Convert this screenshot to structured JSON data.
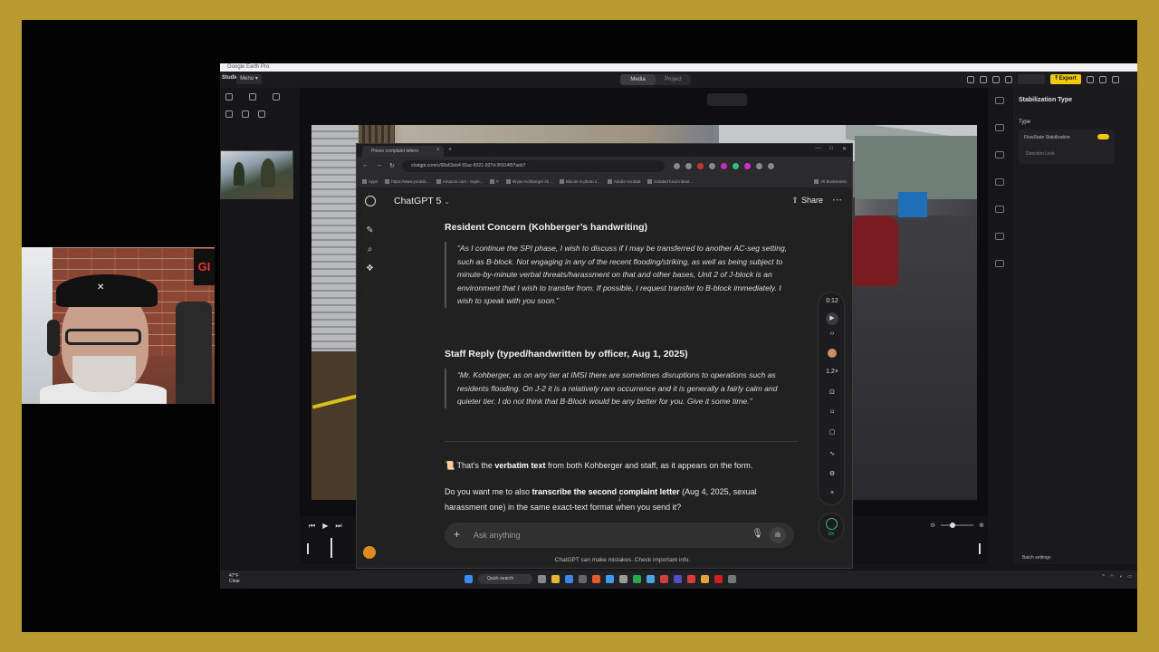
{
  "editor": {
    "window_title": "Google Earth Pro",
    "brand": "Studio",
    "menu_label": "Menu ▾",
    "tabs": [
      {
        "label": "Media",
        "active": true
      },
      {
        "label": "Project",
        "active": false
      }
    ],
    "export_label": "⤒ Export",
    "accent_color": "#f2c80f"
  },
  "right_panel": {
    "title": "Stabilization Type",
    "type_label": "Type",
    "option_1": "FlowState Stabilization",
    "option_1_enabled": true,
    "option_2": "Direction Lock",
    "batch_settings": "Batch settings"
  },
  "browser": {
    "tab_title": "Prison complaint letters",
    "url": "chatgpt.com/c/68a63eb4-55ac-8321-937d-35914f07aeb7",
    "bookmarks": [
      "Apps",
      "https://www.youtub...",
      "Amazon.com - Supe...",
      "F",
      "Bryan Kohberger sh...",
      "Bitcoin in photo s...",
      "Adobe Acrobat",
      "isolated food indust..."
    ],
    "all_bookmarks": "All Bookmarks"
  },
  "chatgpt": {
    "model": "ChatGPT 5",
    "share_label": "Share",
    "section1": {
      "heading": "Resident Concern (Kohberger’s handwriting)",
      "quote": "“As I continue the SPI phase, I wish to discuss if I may be transferred to another AC-seg setting, such as B-block. Not engaging in any of the recent flooding/striking, as well as being subject to minute-by-minute verbal threats/harassment on that and other bases, Unit 2 of J-block is an environment that I wish to transfer from. If possible, I request transfer to B-block immediately. I wish to speak with you soon.”"
    },
    "section2": {
      "heading": "Staff Reply (typed/handwritten by officer, Aug 1, 2025)",
      "quote": "“Mr. Kohberger, as on any tier at IMSI there are sometimes disruptions to operations such as residents flooding. On J-2 it is a relatively rare occurrence and it is generally a fairly calm and quieter tier. I do not think that B-Block would be any better for you. Give it some time.”"
    },
    "p1_emoji": "📜",
    "p1_before": " That’s the ",
    "p1_bold": "verbatim text",
    "p1_after": " from both Kohberger and staff, as it appears on the form.",
    "p2_before": "Do you want me to also ",
    "p2_bold": "transcribe the second complaint letter",
    "p2_after": " (Aug 4, 2025, sexual harassment one) in the same exact-text format when you send it?",
    "input_placeholder": "Ask anything",
    "disclaimer": "ChatGPT can make mistakes. Check important info."
  },
  "read_aloud": {
    "time": "0:12",
    "speed": "1.2×",
    "status": "On"
  },
  "taskbar": {
    "weather_temp": "47°F",
    "weather_desc": "Clear",
    "search_label": "Quick search"
  },
  "webcam": {
    "sign_text": "GI"
  }
}
